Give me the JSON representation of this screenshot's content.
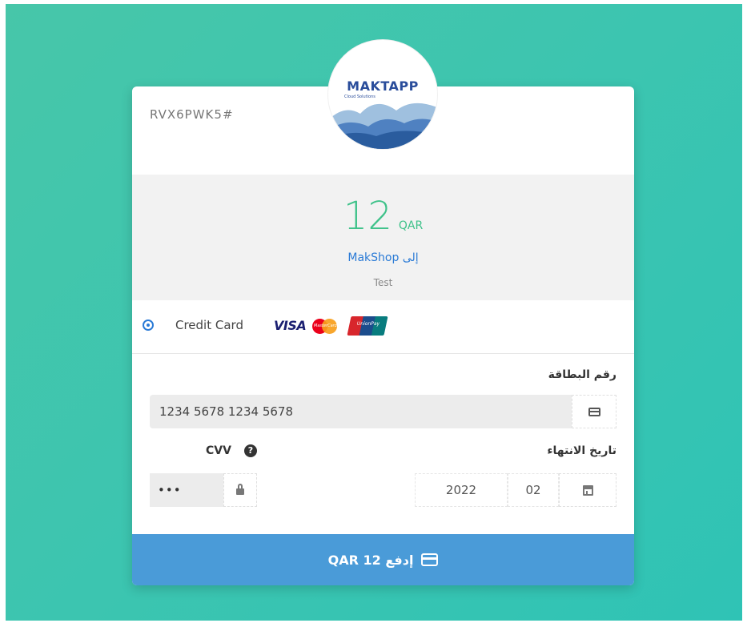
{
  "reference": "RVX6PWK5#",
  "logo": {
    "text": "MAKTAPP",
    "subtitle": "Cloud Solutions"
  },
  "amount": {
    "value": "12",
    "currency": "QAR"
  },
  "merchant_line": "إلى MakShop",
  "description": "Test",
  "payment_method": {
    "label": "Credit Card",
    "brands": [
      "VISA",
      "MasterCard",
      "UnionPay"
    ],
    "selected": true
  },
  "card_number": {
    "label": "رقم البطاقة",
    "value": "1234 5678 1234 5678"
  },
  "expiry": {
    "label": "تاريخ الانتهاء",
    "month": "02",
    "year": "2022"
  },
  "cvv": {
    "label": "CVV",
    "value": "•••",
    "help": "?"
  },
  "pay_button": {
    "label": "إدفع 12 QAR"
  },
  "colors": {
    "background_gradient": [
      "#47c6a9",
      "#2fc3b5"
    ],
    "accent_green": "#3fc28a",
    "link_blue": "#2b7bd6",
    "button_blue": "#4a9bd8"
  }
}
